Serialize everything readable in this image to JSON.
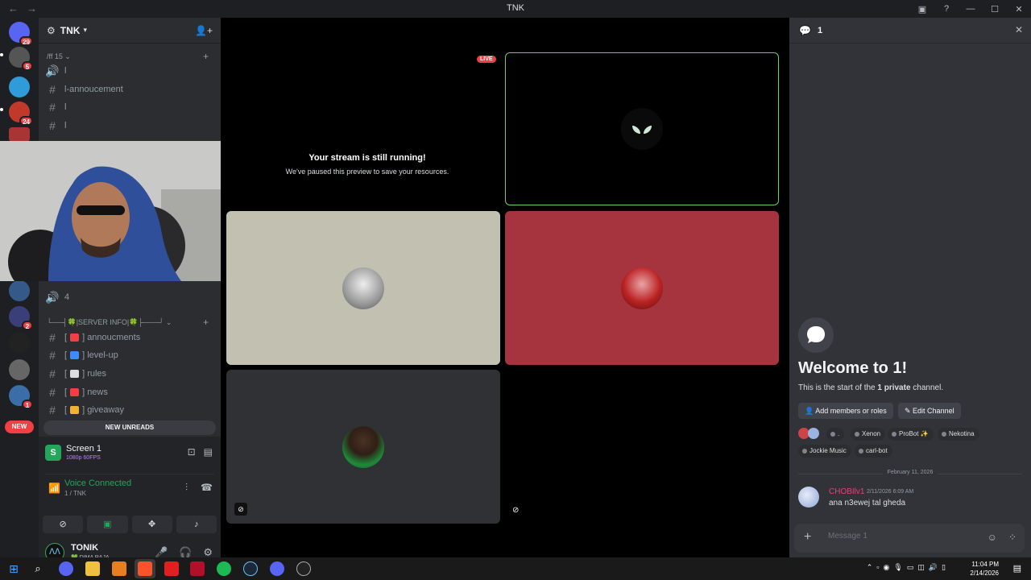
{
  "window": {
    "title": "TNK",
    "back": "←",
    "forward": "→",
    "controls": [
      "▣",
      "?",
      "—",
      "☐",
      "✕"
    ]
  },
  "rail": {
    "badges": [
      "29",
      "5",
      "24",
      "2",
      "1"
    ],
    "new_label": "NEW"
  },
  "guild": {
    "name": "TNK"
  },
  "categories": {
    "first": "/ff 15",
    "server_info": "└──┤🍀|SERVER INFO|🍀├───┘"
  },
  "channels": [
    {
      "name": "l",
      "type": "voice"
    },
    {
      "name": "l-annoucement",
      "type": "text"
    },
    {
      "name": "l",
      "type": "text"
    },
    {
      "name": "l",
      "type": "text"
    }
  ],
  "voice_channel_4": "4",
  "info_channels": [
    {
      "name": "annoucments",
      "emoji_color": "#f23f43"
    },
    {
      "name": "level-up",
      "emoji_color": "#3c8cff"
    },
    {
      "name": "rules",
      "emoji_color": "#dbdee1"
    },
    {
      "name": "news",
      "emoji_color": "#f23f43"
    },
    {
      "name": "giveaway",
      "emoji_color": "#f0b232"
    }
  ],
  "new_unreads": "NEW UNREADS",
  "screen": {
    "title": "Screen 1",
    "sub": "1080p 60FPS"
  },
  "voice": {
    "status": "Voice Connected",
    "channel": "1 / TNK"
  },
  "user": {
    "name": "TONIK",
    "status": "💚 DIMA RAJA"
  },
  "stage": {
    "live": "LIVE",
    "stream_title": "Your stream is still running!",
    "stream_sub": "We've paused this preview to save your resources."
  },
  "chat": {
    "channel_name": "1",
    "welcome_title": "Welcome to 1!",
    "welcome_pre": "This is the start of the ",
    "welcome_count": "1",
    "welcome_private": "private",
    "welcome_post": " channel.",
    "add_members": "Add members or roles",
    "edit_channel": "Edit Channel",
    "chips": [
      ".",
      "Xenon",
      "ProBot ✨",
      "Nekotina",
      "Jockie Music",
      "carl-bot"
    ],
    "date_divider": "February 11, 2026",
    "message": {
      "author": "CHOBIlv1",
      "time": "2/11/2026 6:09 AM",
      "text": "ana n3ewej tal gheda"
    },
    "composer_placeholder": "Message 1"
  },
  "taskbar": {
    "time": "11:04 PM",
    "date": "2/14/2026"
  },
  "colors": {
    "accent_green": "#23a55a",
    "red": "#f23f43",
    "tile_beige": "#c2c0b1",
    "tile_red": "#a5343f",
    "tile_gray": "#2f3134"
  }
}
